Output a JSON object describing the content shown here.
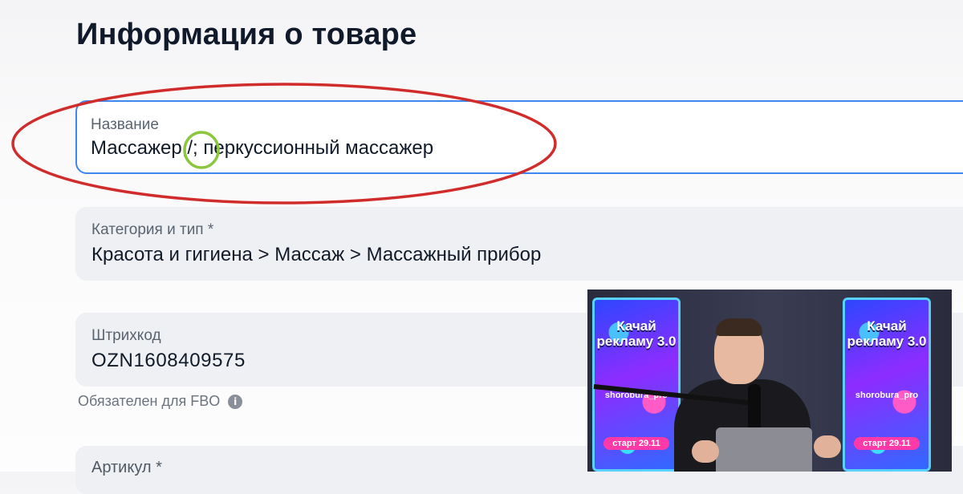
{
  "page_title": "Информация о товаре",
  "fields": {
    "name": {
      "label": "Название",
      "value": "Массажер,/; перкуссионный массажер"
    },
    "category": {
      "label": "Категория и тип *",
      "value": "Красота и гигиена > Массаж > Массажный прибор"
    },
    "barcode": {
      "label": "Штрихкод",
      "value": "OZN1608409575",
      "hint": "Обязателен для FBO"
    },
    "article": {
      "label": "Артикул *"
    }
  },
  "annotation_colors": {
    "ellipse": "#d12c2c",
    "circle": "#8cc63f"
  },
  "accent_color": "#3e86f0",
  "webcam": {
    "banner_left": {
      "title": "Качай рекламу 3.0",
      "handle": "shorobura_pro",
      "start": "старт 29.11"
    },
    "banner_right": {
      "title": "Качай рекламу 3.0",
      "handle": "shorobura_pro",
      "start": "старт 29.11"
    }
  }
}
